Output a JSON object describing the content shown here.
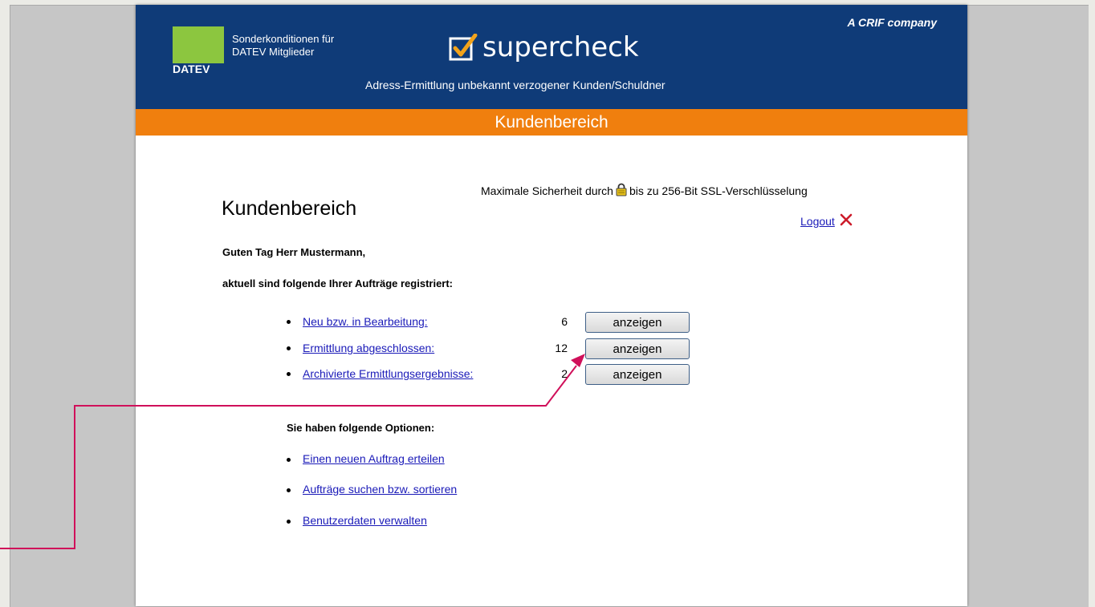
{
  "header": {
    "datev_logo_text": "DATEV",
    "note_line1": "Sonderkonditionen für",
    "note_line2": "DATEV Mitglieder",
    "brand": "supercheck",
    "tagline": "Adress-Ermittlung unbekannt verzogener Kunden/Schuldner",
    "crif": "A CRIF company"
  },
  "subbar": {
    "title": "Kundenbereich"
  },
  "security": {
    "before": "Maximale Sicherheit durch",
    "after": "bis zu 256-Bit SSL-Verschlüsselung",
    "icon": "lock-icon"
  },
  "main": {
    "title": "Kundenbereich",
    "logout": "Logout",
    "greeting": "Guten Tag Herr Mustermann,",
    "intro": "aktuell sind folgende Ihrer Aufträge registriert:",
    "orders": [
      {
        "label": "Neu bzw. in Bearbeitung:",
        "count": "6",
        "button": "anzeigen"
      },
      {
        "label": "Ermittlung abgeschlossen:",
        "count": "12",
        "button": "anzeigen"
      },
      {
        "label": "Archivierte Ermittlungsergebnisse:",
        "count": "2",
        "button": "anzeigen"
      }
    ],
    "options_title": "Sie haben folgende Optionen:",
    "options": [
      {
        "label": "Einen neuen Auftrag erteilen"
      },
      {
        "label": "Aufträge suchen bzw. sortieren"
      },
      {
        "label": "Benutzerdaten verwalten"
      }
    ]
  },
  "colors": {
    "header_bg": "#0f3b78",
    "subbar_bg": "#f07f0e",
    "datev_green": "#8cc63f",
    "link": "#1a1ab8",
    "annotation": "#d0105a",
    "logout_x": "#cc1b2a"
  }
}
